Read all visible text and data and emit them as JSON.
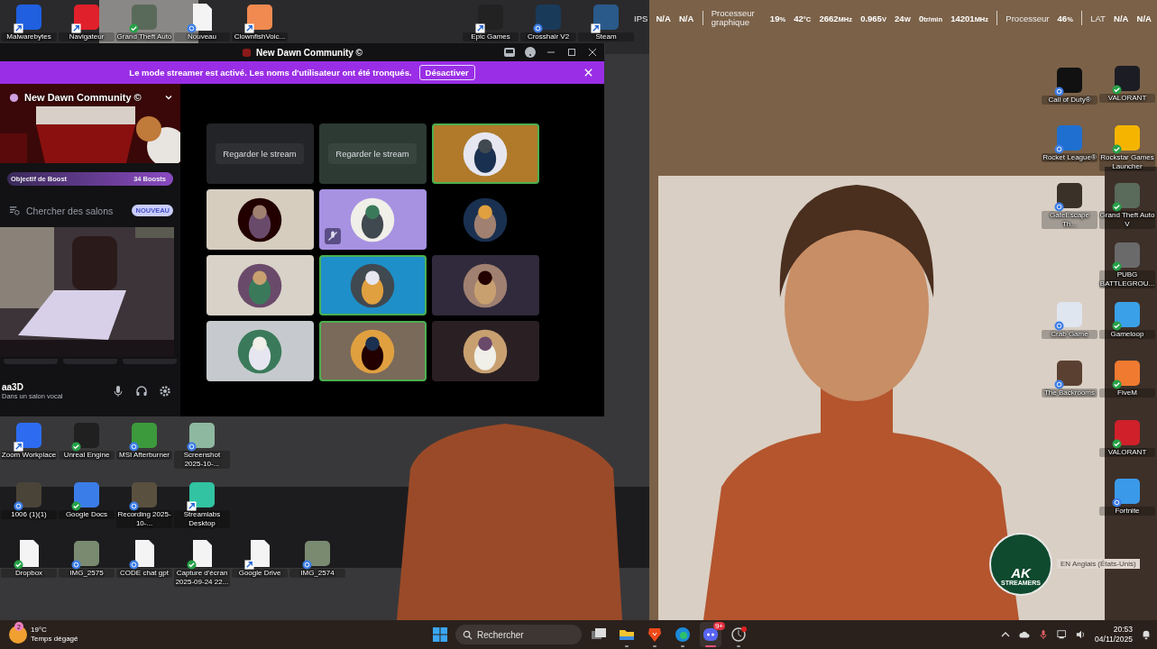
{
  "desktop_icons": {
    "top": [
      {
        "label": "Malwarebytes",
        "kind": "shortcut",
        "color": "#1f5fe0"
      },
      {
        "label": "Navigateur",
        "kind": "shortcut",
        "color": "#e0202a"
      },
      {
        "label": "Grand Theft Auto",
        "kind": "synced",
        "color": "#5a6a5a"
      },
      {
        "label": "Nouveau",
        "kind": "syncing"
      },
      {
        "label": "ClownfishVoic...",
        "kind": "shortcut",
        "color": "#f08a50"
      },
      {
        "label": "Epic Games",
        "kind": "shortcut",
        "color": "#222222"
      },
      {
        "label": "Crosshair V2",
        "kind": "syncing",
        "color": "#1a3a5a"
      },
      {
        "label": "Steam",
        "kind": "shortcut",
        "color": "#2a5a8a"
      }
    ],
    "left": [
      {
        "label": "Zoom Workplace",
        "kind": "shortcut",
        "color": "#2d6cf0"
      },
      {
        "label": "Unreal Engine",
        "kind": "synced",
        "color": "#202020"
      },
      {
        "label": "MSI Afterburner",
        "kind": "syncing",
        "color": "#3c9a3c"
      },
      {
        "label": "Screenshot 2025-10-...",
        "kind": "syncing",
        "color": "#8fb8a0"
      },
      {
        "label": "1006 (1)(1)",
        "kind": "syncing",
        "color": "#4a4438"
      },
      {
        "label": "Google Docs",
        "kind": "synced",
        "color": "#3b7de8"
      },
      {
        "label": "Recording 2025-10-...",
        "kind": "syncing",
        "color": "#5a5040"
      },
      {
        "label": "Streamlabs Desktop",
        "kind": "shortcut",
        "color": "#31c3a2"
      },
      {
        "label": "Dropbox",
        "kind": "synced"
      },
      {
        "label": "IMG_2575",
        "kind": "syncing",
        "color": "#7a8a70"
      },
      {
        "label": "CODE chat gpt",
        "kind": "syncing"
      },
      {
        "label": "Capture d'écran 2025-09-24 22...",
        "kind": "synced"
      },
      {
        "label": "Google Drive",
        "kind": "shortcut"
      },
      {
        "label": "IMG_2574",
        "kind": "syncing",
        "color": "#7a8a71"
      }
    ],
    "right_a": [
      {
        "label": "Call of Duty®",
        "kind": "syncing",
        "color": "#111111"
      },
      {
        "label": "Rocket League®",
        "kind": "syncing",
        "color": "#1f6fd0"
      },
      {
        "label": "GateEscape Th...",
        "kind": "syncing",
        "color": "#3a3228"
      },
      {
        "label": "Crab Game",
        "kind": "syncing",
        "color": "#dfe6f0"
      },
      {
        "label": "The Backrooms",
        "kind": "syncing",
        "color": "#5a4030"
      }
    ],
    "right_b": [
      {
        "label": "VALORANT",
        "kind": "synced",
        "color": "#1c1c24"
      },
      {
        "label": "Rockstar Games Launcher",
        "kind": "synced",
        "color": "#f4b400"
      },
      {
        "label": "Grand Theft Auto V",
        "kind": "synced",
        "color": "#5a6a5b"
      },
      {
        "label": "PUBG BATTLEGROU...",
        "kind": "synced",
        "color": "#6a6a6a"
      },
      {
        "label": "Gameloop",
        "kind": "synced",
        "color": "#3aa0e8"
      },
      {
        "label": "FiveM",
        "kind": "synced",
        "color": "#f07a30"
      },
      {
        "label": "VALORANT",
        "kind": "synced",
        "color": "#d0202a"
      },
      {
        "label": "Fortnite",
        "kind": "syncing",
        "color": "#3a9ae9"
      }
    ]
  },
  "perf_overlay": [
    {
      "label": "IPS",
      "readings": [
        {
          "value": "N/A"
        },
        {
          "value": "N/A"
        }
      ]
    },
    {
      "label": "Processeur graphique",
      "readings": [
        {
          "value": "19",
          "unit": "%"
        },
        {
          "value": "42",
          "unit": "°C"
        },
        {
          "value": "2662",
          "unit": "MHz"
        },
        {
          "value": "0.965",
          "unit": "V"
        },
        {
          "value": "24",
          "unit": "W"
        },
        {
          "value": "0",
          "unit": "tr/min"
        },
        {
          "value": "14201",
          "unit": "MHz"
        }
      ]
    },
    {
      "label": "Processeur",
      "readings": [
        {
          "value": "46",
          "unit": "%"
        }
      ]
    },
    {
      "label": "LAT",
      "readings": [
        {
          "value": "N/A"
        },
        {
          "value": "N/A"
        }
      ]
    }
  ],
  "discord": {
    "window_title": "New Dawn Community ©",
    "banner": {
      "text": "Le mode streamer est activé. Les noms d'utilisateur ont été tronqués.",
      "button": "Désactiver"
    },
    "server_name": "New Dawn Community ©",
    "boost": {
      "label": "Objectif de Boost",
      "count": "34 Boosts"
    },
    "channel_search": {
      "label": "Chercher des salons",
      "badge": "NOUVEAU"
    },
    "user": {
      "name": "aa3D",
      "status": "Dans un salon vocal"
    },
    "tiles": [
      {
        "kind": "stream",
        "label": "Regarder le stream",
        "color": "#232428",
        "speaking": false,
        "muted": false
      },
      {
        "kind": "stream",
        "label": "Regarder le stream",
        "color": "#2c3a33",
        "speaking": false,
        "muted": false
      },
      {
        "kind": "avatar",
        "color": "#b07a2a",
        "speaking": true,
        "muted": false
      },
      {
        "kind": "avatar",
        "color": "#d6cdbf",
        "speaking": false,
        "muted": false
      },
      {
        "kind": "avatar",
        "color": "#a792e2",
        "speaking": false,
        "muted": true
      },
      {
        "kind": "avatar",
        "color": "#000000",
        "speaking": false,
        "muted": false
      },
      {
        "kind": "avatar",
        "color": "#d8d2c8",
        "speaking": false,
        "muted": false
      },
      {
        "kind": "avatar",
        "color": "#1e8fc8",
        "speaking": true,
        "muted": false
      },
      {
        "kind": "avatar",
        "color": "#302a3c",
        "speaking": false,
        "muted": false
      },
      {
        "kind": "avatar",
        "color": "#c6cace",
        "speaking": false,
        "muted": false
      },
      {
        "kind": "avatar",
        "color": "#7a6a5a",
        "speaking": true,
        "muted": false
      },
      {
        "kind": "avatar",
        "color": "#2a2024",
        "speaking": false,
        "muted": false
      }
    ]
  },
  "stream_logo": {
    "title": "AK",
    "subtitle": "STREAMERS"
  },
  "language_hint": "EN Anglais (États-Unis)",
  "taskbar": {
    "weather": {
      "temp": "19°C",
      "condition": "Temps dégagé",
      "badge": "2"
    },
    "search": {
      "placeholder": "Rechercher"
    },
    "apps": [
      {
        "kind": "taskview",
        "running": false,
        "active": false
      },
      {
        "kind": "files",
        "running": true,
        "active": false
      },
      {
        "kind": "brave",
        "running": true,
        "active": false
      },
      {
        "kind": "edge",
        "running": true,
        "active": false
      },
      {
        "kind": "discord",
        "running": true,
        "active": true,
        "badge": "9+"
      },
      {
        "kind": "other",
        "running": true,
        "active": false
      }
    ],
    "time": "20:53",
    "date": "04/11/2025"
  }
}
